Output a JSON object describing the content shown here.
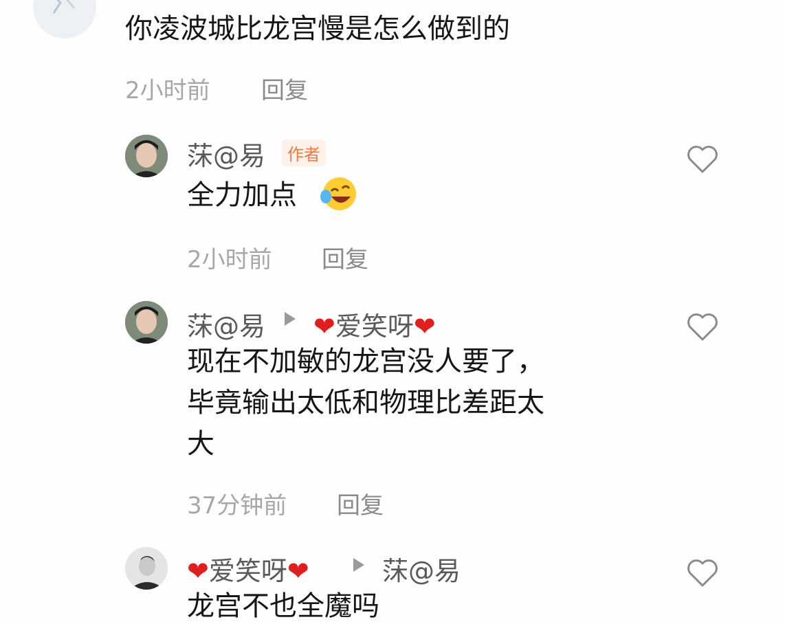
{
  "comments": [
    {
      "body": "你凌波城比龙宫慢是怎么做到的",
      "time": "2小时前",
      "reply_label": "回复",
      "avatar_icon": "avatar-partial-icon"
    },
    {
      "username": "莯@易",
      "author_tag": "作者",
      "body": "全力加点",
      "emoji": "crying-laughing-emoji",
      "time": "2小时前",
      "reply_label": "回复",
      "like_icon": "heart-outline-icon"
    },
    {
      "username": "莯@易",
      "reply_to": "爱笑呀",
      "body_lines": [
        "现在不加敏的龙宫没人要了，",
        "毕竟输出太低和物理比差距太",
        "大"
      ],
      "time": "37分钟前",
      "reply_label": "回复",
      "like_icon": "heart-outline-icon"
    },
    {
      "username": "爱笑呀",
      "reply_to": "莯@易",
      "body": "龙宫不也全魔吗",
      "like_icon": "heart-outline-icon"
    }
  ],
  "colors": {
    "accent_tag": "#f07842",
    "heart_red": "#e01e1e",
    "meta_gray": "#a7a7a7"
  }
}
